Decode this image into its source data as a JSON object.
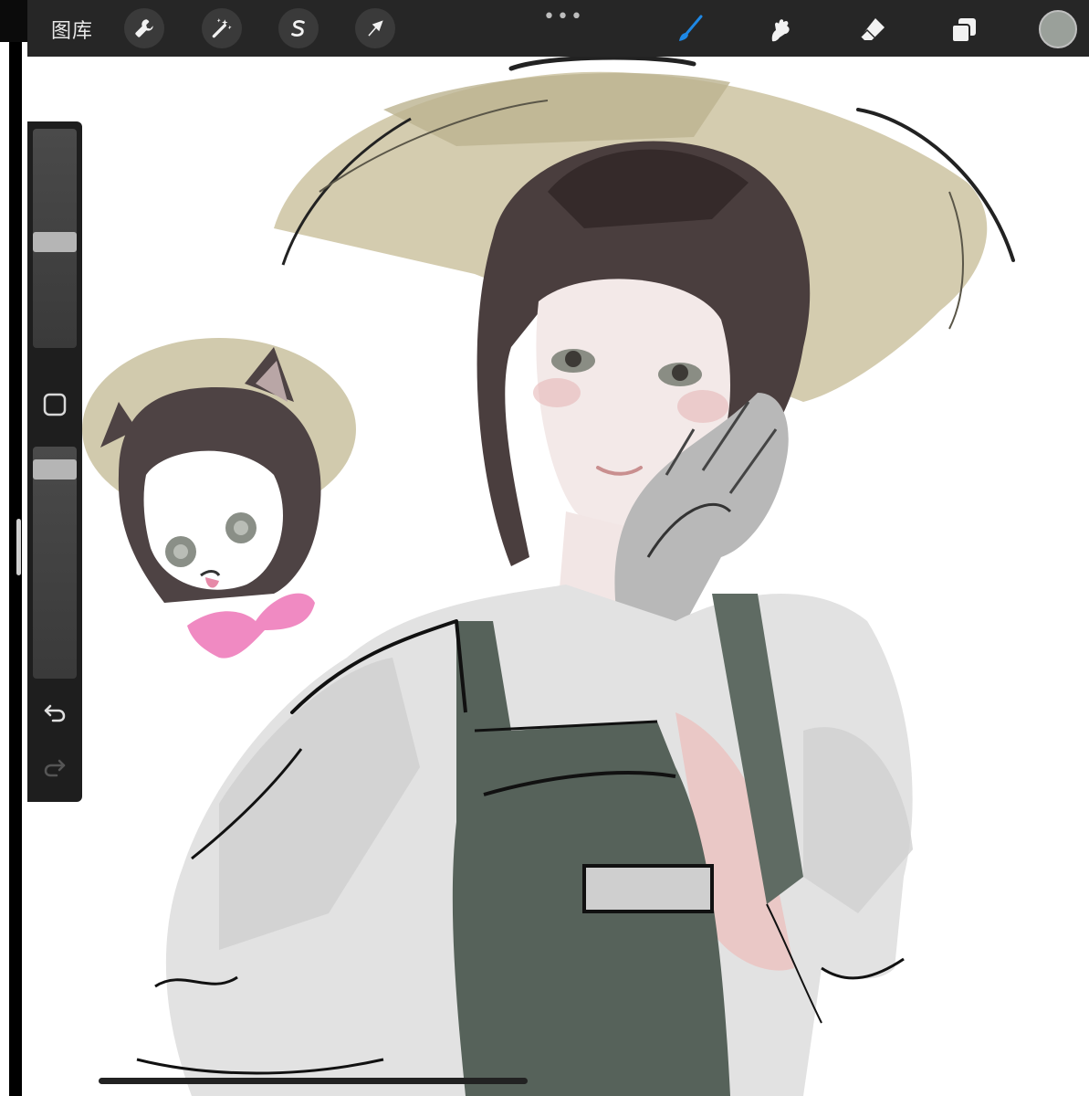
{
  "toolbar": {
    "gallery_label": "图库",
    "left_tools": [
      {
        "name": "wrench-icon",
        "label": "actions"
      },
      {
        "name": "magic-wand-icon",
        "label": "adjustments"
      },
      {
        "name": "selection-s-icon",
        "label": "selection"
      },
      {
        "name": "arrow-cursor-icon",
        "label": "transform"
      }
    ],
    "more_label": "•••",
    "right_tools": [
      {
        "name": "brush-icon",
        "active": true
      },
      {
        "name": "smudge-icon",
        "active": false
      },
      {
        "name": "eraser-icon",
        "active": false
      },
      {
        "name": "layers-icon",
        "active": false
      }
    ],
    "current_color": "#9aa09a",
    "active_color": "#1e88e5"
  },
  "sidebar": {
    "brush_size_level": 0.48,
    "opacity_level": 0.94,
    "modify_icon": "square-icon",
    "undo_icon": "undo-icon",
    "redo_icon": "redo-icon"
  },
  "canvas": {
    "background": "#ffffff"
  }
}
